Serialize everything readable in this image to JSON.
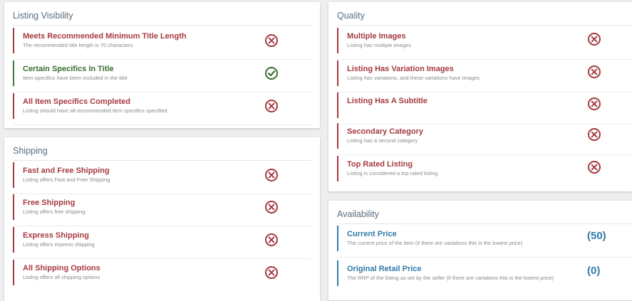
{
  "colors": {
    "fail": "#a63a3f",
    "pass": "#3b7a3b",
    "info": "#3a7ea8"
  },
  "listing_visibility": {
    "title": "Listing Visibility",
    "items": [
      {
        "label": "Meets Recommended Minimum Title Length",
        "desc": "The recommended title length is 70 characters",
        "status": "fail",
        "icon": "x-circle-icon"
      },
      {
        "label": "Certain Specifics In Title",
        "desc": "Item specifics have been included in the title",
        "status": "pass",
        "icon": "check-circle-icon"
      },
      {
        "label": "All Item Specifics Completed",
        "desc": "Listing should have all recommended item specifics specified",
        "status": "fail",
        "icon": "x-circle-icon"
      }
    ]
  },
  "shipping": {
    "title": "Shipping",
    "items": [
      {
        "label": "Fast and Free Shipping",
        "desc": "Listing offers Fast and Free Shipping",
        "status": "fail",
        "icon": "x-circle-icon"
      },
      {
        "label": "Free Shipping",
        "desc": "Listing offers free shipping",
        "status": "fail",
        "icon": "x-circle-icon"
      },
      {
        "label": "Express Shipping",
        "desc": "Listing offers express shipping",
        "status": "fail",
        "icon": "x-circle-icon"
      },
      {
        "label": "All Shipping Options",
        "desc": "Listing offers all shipping options",
        "status": "fail",
        "icon": "x-circle-icon"
      }
    ]
  },
  "quality": {
    "title": "Quality",
    "items": [
      {
        "label": "Multiple Images",
        "desc": "Listing has multiple images",
        "status": "fail",
        "icon": "x-circle-icon"
      },
      {
        "label": "Listing Has Variation Images",
        "desc": "Listing has variations, and these variations have images",
        "status": "fail",
        "icon": "x-circle-icon"
      },
      {
        "label": "Listing Has A Subtitle",
        "desc": "",
        "status": "fail",
        "icon": "x-circle-icon"
      },
      {
        "label": "Secondary Category",
        "desc": "Listing has a second category",
        "status": "fail",
        "icon": "x-circle-icon"
      },
      {
        "label": "Top Rated Listing",
        "desc": "Listing is considered a top rated listing",
        "status": "fail",
        "icon": "x-circle-icon"
      }
    ]
  },
  "availability": {
    "title": "Availability",
    "items": [
      {
        "label": "Current Price",
        "desc": "The current price of the item (if there are variations this is the lowest price)",
        "value": "(50)"
      },
      {
        "label": "Original Retail Price",
        "desc": "The RRP of the listing as set by the seller (if there are variations this is the lowest price)",
        "value": "(0)"
      }
    ]
  }
}
